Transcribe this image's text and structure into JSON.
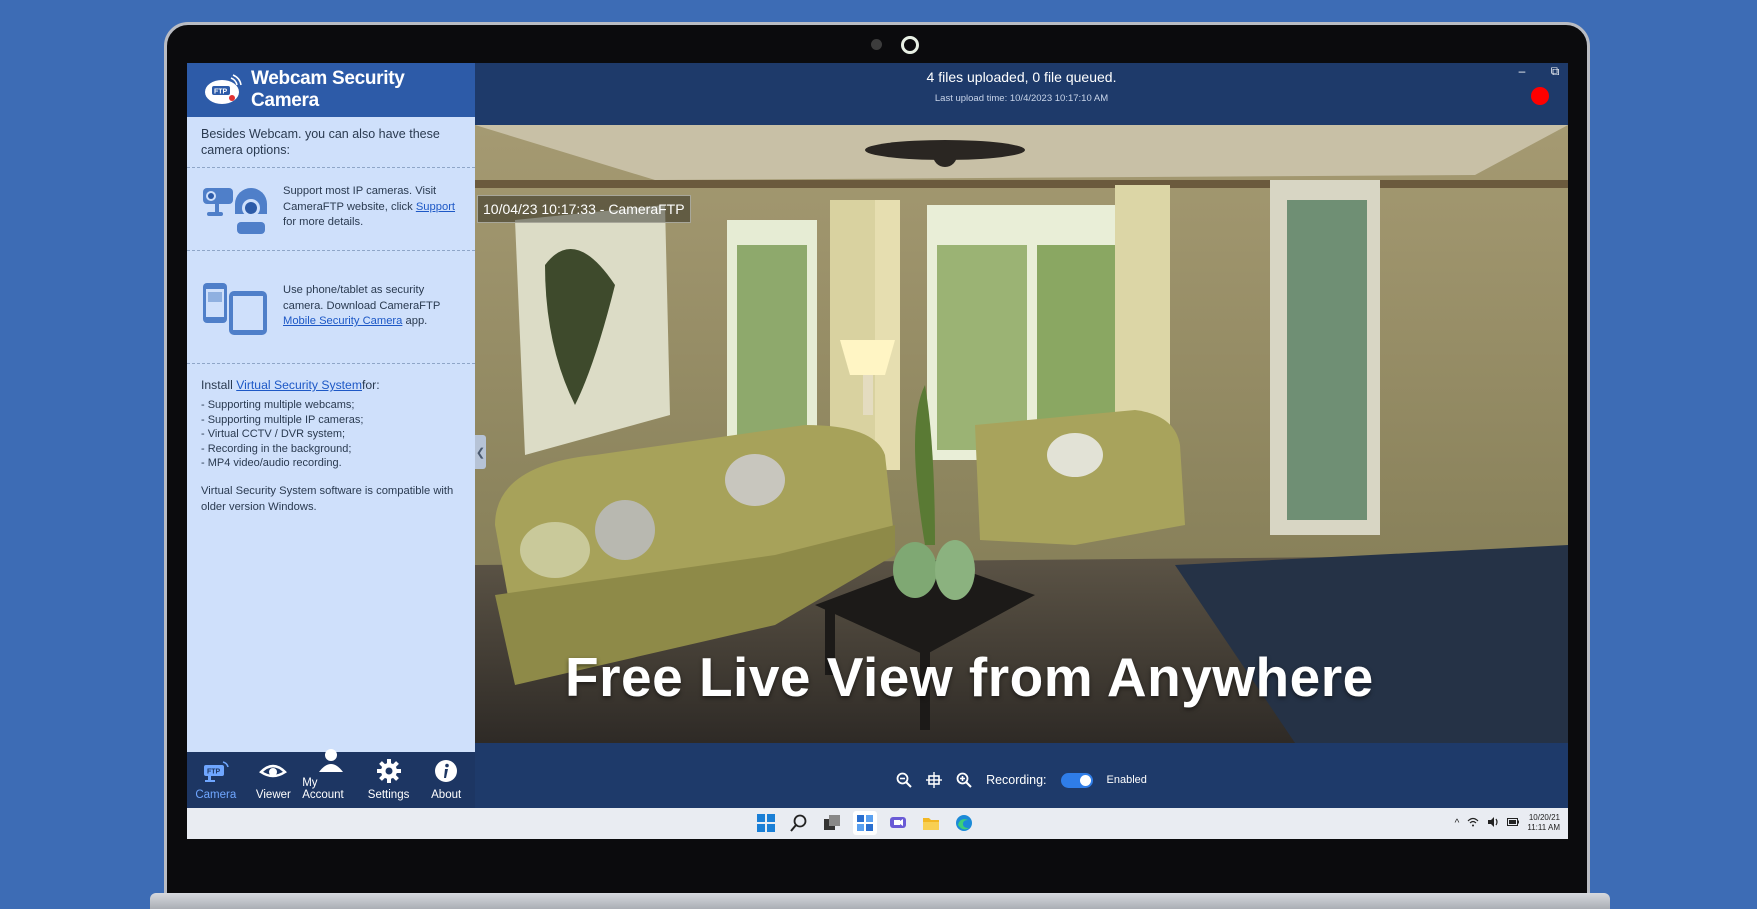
{
  "app": {
    "title": "Webcam Security Camera"
  },
  "sidebar": {
    "intro": "Besides Webcam. you can also have these camera options:",
    "ip_option": {
      "text1": "Support most IP cameras. Visit CameraFTP website, click ",
      "link": "Support",
      "text2": " for more details."
    },
    "phone_option": {
      "text1": "Use phone/tablet as security camera. Download CameraFTP ",
      "link": "Mobile Security Camera",
      "text2": " app."
    },
    "install": {
      "prefix": "Install",
      "link": "Virtual Security System",
      "suffix": "for:",
      "items": [
        "-  Supporting multiple webcams;",
        "-  Supporting multiple IP cameras;",
        "-  Virtual CCTV / DVR system;",
        "-  Recording in the background;",
        "-  MP4 video/audio recording."
      ]
    },
    "compat_note": "Virtual Security System software is compatible with older version Windows."
  },
  "nav": [
    {
      "label": "Camera",
      "icon": "camera-icon",
      "active": true
    },
    {
      "label": "Viewer",
      "icon": "eye-icon",
      "active": false
    },
    {
      "label": "My Account",
      "icon": "user-icon",
      "active": false
    },
    {
      "label": "Settings",
      "icon": "gear-icon",
      "active": false
    },
    {
      "label": "About",
      "icon": "info-icon",
      "active": false
    }
  ],
  "status": {
    "main": "4 files uploaded, 0 file queued.",
    "sub": "Last upload time: 10/4/2023 10:17:10 AM"
  },
  "window_controls": {
    "minimize": "–",
    "restore": "⧉",
    "close": "✕"
  },
  "viewer": {
    "timestamp": "10/04/23 10:17:33 - CameraFTP",
    "overlay": "Free Live View from Anywhere",
    "collapse": "❮"
  },
  "controls": {
    "recording_label": "Recording:",
    "recording_state": "Enabled",
    "recording_on": true
  },
  "taskbar": {
    "date": "10/20/21",
    "time": "11:11 AM",
    "tray_chevron": "^"
  },
  "colors": {
    "background": "#3d6cb5",
    "sidebar": "#cfe0fb",
    "header": "#2d5ba8",
    "app_bar": "#1e3a6a",
    "nav_active": "#6fa6ff",
    "record_dot": "#ff0000",
    "link": "#1d58c6"
  }
}
